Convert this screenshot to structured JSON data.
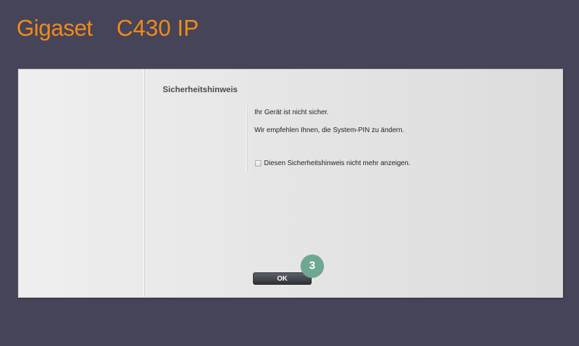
{
  "header": {
    "brand": "Gigaset",
    "model": "C430 IP"
  },
  "dialog": {
    "title": "Sicherheitshinweis",
    "message_line1": "Ihr Gerät ist nicht sicher.",
    "message_line2": "Wir empfehlen Ihnen, die System-PIN zu ändern.",
    "checkbox_label": "Diesen Sicherheitshinweis nicht mehr anzeigen.",
    "checkbox_checked": false,
    "ok_label": "OK"
  },
  "annotation": {
    "step_number": "3"
  },
  "colors": {
    "background": "#464458",
    "brand": "#f08a1a",
    "badge": "#6ea892",
    "button": "#3a3d44"
  }
}
